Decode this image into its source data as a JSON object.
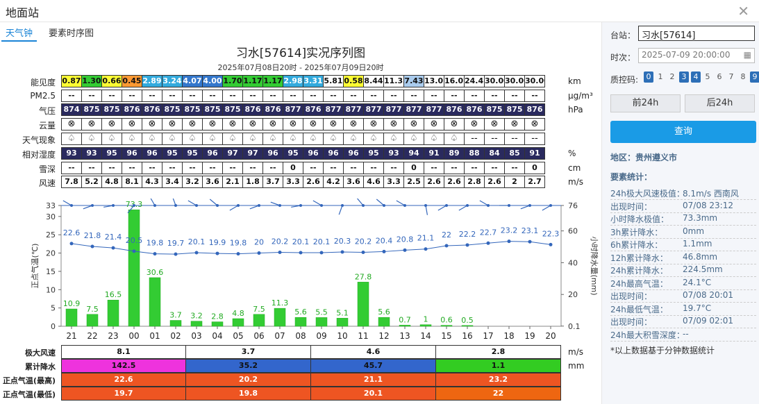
{
  "window": {
    "title": "地面站"
  },
  "tabs": [
    "天气钟",
    "要素时序图"
  ],
  "chart": {
    "title": "习水[57614]实况序列图",
    "subtitle": "2025年07月08日20时 - 2025年07月09日20时"
  },
  "hours": [
    "21",
    "22",
    "23",
    "00",
    "01",
    "02",
    "03",
    "04",
    "05",
    "06",
    "07",
    "08",
    "09",
    "10",
    "11",
    "12",
    "13",
    "14",
    "15",
    "16",
    "17",
    "18",
    "19",
    "20"
  ],
  "rows": {
    "visibility": {
      "label": "能见度",
      "unit": "km",
      "values": [
        "0.87",
        "1.30",
        "0.66",
        "0.45",
        "2.89",
        "3.24",
        "4.07",
        "4.00",
        "1.70",
        "1.17",
        "1.17",
        "2.98",
        "3.31",
        "5.81",
        "0.58",
        "8.44",
        "11.33",
        "7.43",
        "13.02",
        "16.07",
        "24.42",
        "30.00",
        "30.00",
        "30.00"
      ],
      "colors": [
        "#ffff33",
        "#33cc33",
        "#ffff33",
        "#ff9933",
        "#33aadd",
        "#33aadd",
        "#3377cc",
        "#3377cc",
        "#33cc33",
        "#33cc33",
        "#33cc33",
        "#33aadd",
        "#33aadd",
        "#ffffff",
        "#ffff33",
        "#ffffff",
        "#ffffff",
        "#aaccee",
        "#ffffff",
        "#ffffff",
        "#ffffff",
        "#ffffff",
        "#ffffff",
        "#ffffff"
      ]
    },
    "pm25": {
      "label": "PM2.5",
      "unit": "μg/m³",
      "values": [
        "--",
        "--",
        "--",
        "--",
        "--",
        "--",
        "--",
        "--",
        "--",
        "--",
        "--",
        "--",
        "--",
        "--",
        "--",
        "--",
        "--",
        "--",
        "--",
        "--",
        "--",
        "--",
        "--",
        "--"
      ]
    },
    "pressure": {
      "label": "气压",
      "unit": "hPa",
      "values": [
        "874",
        "875",
        "875",
        "876",
        "876",
        "875",
        "875",
        "875",
        "875",
        "876",
        "876",
        "877",
        "876",
        "877",
        "877",
        "877",
        "877",
        "877",
        "877",
        "876",
        "876",
        "875",
        "875",
        "876"
      ]
    },
    "cloud": {
      "label": "云量",
      "unit": "",
      "values": [
        "⊗",
        "⊗",
        "⊗",
        "⊗",
        "⊗",
        "⊗",
        "⊗",
        "⊗",
        "⊗",
        "⊗",
        "⊗",
        "⊗",
        "⊗",
        "⊗",
        "⊗",
        "⊗",
        "⊗",
        "⊗",
        "⊗",
        "⊗",
        "⊗",
        "⊗",
        "⊗",
        "⊗"
      ]
    },
    "weather": {
      "label": "天气现象",
      "unit": "",
      "values": [
        "♤",
        "♤",
        "♤",
        "♤",
        "♤",
        "♤",
        "♤",
        "♤",
        "♤",
        "♤",
        "♤",
        "♤",
        "♤",
        "♤",
        "♤",
        "♤",
        "♤",
        "♤",
        "♤",
        "♤",
        "--",
        "--",
        "--",
        "--"
      ]
    },
    "humidity": {
      "label": "相对湿度",
      "unit": "%",
      "values": [
        "93",
        "93",
        "95",
        "96",
        "96",
        "95",
        "95",
        "96",
        "97",
        "97",
        "96",
        "95",
        "96",
        "96",
        "96",
        "95",
        "93",
        "94",
        "91",
        "89",
        "88",
        "84",
        "85",
        "91"
      ]
    },
    "snow": {
      "label": "雪深",
      "unit": "cm",
      "values": [
        "--",
        "--",
        "--",
        "--",
        "--",
        "--",
        "--",
        "--",
        "--",
        "--",
        "--",
        "0",
        "--",
        "--",
        "--",
        "--",
        "--",
        "0",
        "--",
        "--",
        "--",
        "--",
        "--",
        "0"
      ]
    },
    "wind": {
      "label": "风速",
      "unit": "m/s",
      "values": [
        "7.8",
        "5.2",
        "4.8",
        "8.1",
        "4.3",
        "3.4",
        "3.2",
        "3.6",
        "2.1",
        "1.8",
        "3.7",
        "3.3",
        "2.6",
        "4.2",
        "3.6",
        "4.6",
        "3.3",
        "2.5",
        "2.6",
        "2.6",
        "2.8",
        "2.6",
        "2",
        "2.7"
      ]
    }
  },
  "chart_data": {
    "type": "bar",
    "categories": [
      "21",
      "22",
      "23",
      "00",
      "01",
      "02",
      "03",
      "04",
      "05",
      "06",
      "07",
      "08",
      "09",
      "10",
      "11",
      "12",
      "13",
      "14",
      "15",
      "16",
      "17",
      "18",
      "19",
      "20"
    ],
    "temperature_values": [
      22.6,
      21.8,
      21.4,
      20.5,
      19.8,
      19.7,
      20.1,
      19.9,
      19.8,
      20,
      20.2,
      20.1,
      20.1,
      20.3,
      20.2,
      20.4,
      20.8,
      21.1,
      22,
      22.2,
      22.7,
      23.2,
      23.1,
      22.3
    ],
    "temperature_labels": [
      "22.6",
      "21.8",
      "21.4",
      "20.5",
      "19.8",
      "19.7",
      "20.1",
      "19.9",
      "19.8",
      "20",
      "20.2",
      "20.1",
      "20.1",
      "20.3",
      "20.2",
      "20.4",
      "20.8",
      "21.1",
      "22",
      "22.2",
      "22.7",
      "23.2",
      "23.1",
      "22.3"
    ],
    "precip_values": [
      10.9,
      7.5,
      16.5,
      73.3,
      30.6,
      3.7,
      3.2,
      2.8,
      4.8,
      7.5,
      11.3,
      5.6,
      5.5,
      5.1,
      27.8,
      5.6,
      0.7,
      1,
      0.6,
      0.5,
      0,
      0,
      0,
      0
    ],
    "precip_labels": [
      "10.9",
      "7.5",
      "16.5",
      "73.3",
      "30.6",
      "3.7",
      "3.2",
      "2.8",
      "4.8",
      "7.5",
      "11.3",
      "5.6",
      "5.5",
      "5.1",
      "27.8",
      "5.6",
      "0.7",
      "1",
      "0.6",
      "0.5",
      "",
      "",
      "",
      ""
    ],
    "ylabel_left": "正点气温(℃)",
    "ylabel_right": "小时降水量(mm)",
    "yticks_left": [
      "0",
      "5",
      "10",
      "15",
      "20",
      "25",
      "30",
      "33"
    ],
    "yticks_right": [
      "0.1",
      "20",
      "40",
      "60",
      "76"
    ],
    "ylim_left": [
      0,
      33
    ],
    "ylim_right": [
      0,
      76
    ],
    "wind_directions_deg": [
      300,
      250,
      260,
      220,
      330,
      340,
      300,
      310,
      240,
      250,
      290,
      260,
      300,
      200,
      320,
      310,
      300,
      170,
      240,
      240,
      300,
      270,
      250,
      240
    ]
  },
  "summary": {
    "units": [
      "m/s",
      "mm"
    ],
    "rows": [
      {
        "label": "极大风速",
        "values": [
          "8.1",
          "3.7",
          "4.6",
          "2.8"
        ],
        "colors": [
          "#ffffff",
          "#ffffff",
          "#ffffff",
          "#ffffff"
        ],
        "text_color": "#111111"
      },
      {
        "label": "累计降水",
        "values": [
          "142.5",
          "35.2",
          "45.7",
          "1.1"
        ],
        "colors": [
          "#ee33dd",
          "#3366cc",
          "#3366cc",
          "#33cc22"
        ],
        "text_color": "#111111"
      },
      {
        "label": "正点气温(最高)",
        "values": [
          "22.6",
          "20.2",
          "21.1",
          "23.2"
        ],
        "colors": [
          "#ee5522",
          "#ee5522",
          "#ee5522",
          "#ee5522"
        ],
        "text_color": "#ffffff"
      },
      {
        "label": "正点气温(最低)",
        "values": [
          "19.7",
          "19.8",
          "20.1",
          "22"
        ],
        "colors": [
          "#ee5522",
          "#ee5522",
          "#ee5522",
          "#ee6611"
        ],
        "text_color": "#ffffff"
      }
    ]
  },
  "side": {
    "station_label": "台站：",
    "station_value": "习水[57614]",
    "time_label": "时次：",
    "time_value": "2025-07-09 20:00:00",
    "qc_label": "质控码:",
    "qc_codes": [
      "0",
      "1",
      "2",
      "3",
      "4",
      "5",
      "6",
      "7",
      "8",
      "9"
    ],
    "qc_on": [
      "0",
      "3",
      "4",
      "9"
    ],
    "prev_btn": "前24h",
    "next_btn": "后24h",
    "query_btn": "查询",
    "region": "地区：贵州遵义市",
    "stats_title": "要素统计：",
    "stats": [
      {
        "k": "24h极大风速极值：",
        "v": "8.1m/s 西南风"
      },
      {
        "k": "出现时间：",
        "v": "07/08 23:12"
      },
      {
        "k": "小时降水极值：",
        "v": "73.3mm"
      },
      {
        "k": "3h累计降水：",
        "v": "0mm"
      },
      {
        "k": "6h累计降水：",
        "v": "1.1mm"
      },
      {
        "k": "12h累计降水：",
        "v": "46.8mm"
      },
      {
        "k": "24h累计降水：",
        "v": "224.5mm"
      },
      {
        "k": "24h最高气温：",
        "v": "24.1°C"
      },
      {
        "k": "出现时间：",
        "v": "07/08 20:01"
      },
      {
        "k": "24h最低气温：",
        "v": "19.7°C"
      },
      {
        "k": "出现时间：",
        "v": "07/09 02:01"
      },
      {
        "k": "24h最大积雪深度：",
        "v": "--"
      }
    ],
    "note": "*以上数据基于分钟数据统计"
  },
  "colors": {
    "accent": "#1a84d6",
    "query": "#1a9be6",
    "bar": "#33cc33",
    "line": "#3366bb"
  }
}
